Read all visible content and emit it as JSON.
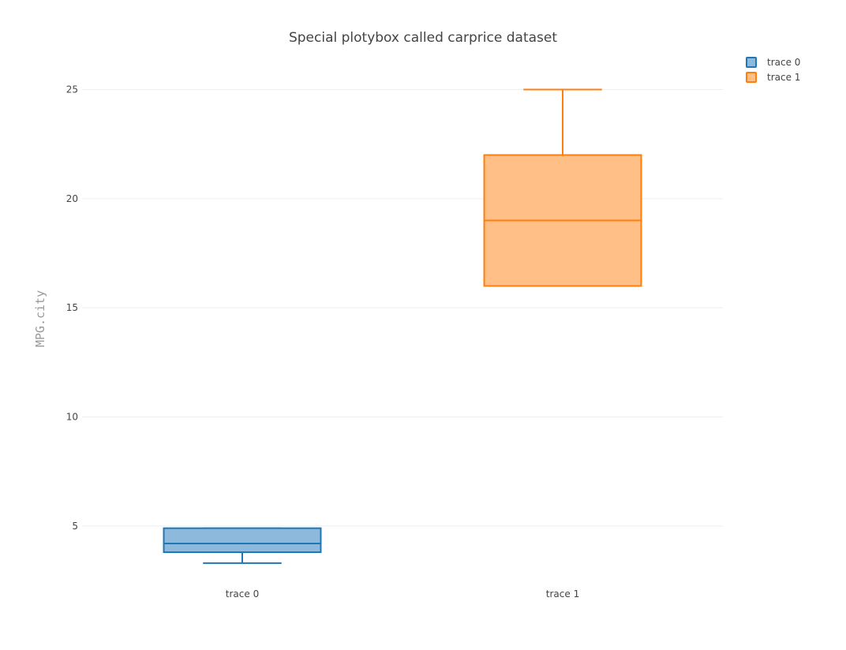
{
  "chart_data": {
    "type": "box",
    "title": "Special plotybox called carprice dataset",
    "xlabel": "",
    "ylabel": "MPG.city",
    "ylim": [
      2.5,
      26.5
    ],
    "yticks": [
      5,
      10,
      15,
      20,
      25
    ],
    "grid": true,
    "legend_position": "top-right",
    "categories": [
      "trace 0",
      "trace 1"
    ],
    "series": [
      {
        "name": "trace 0",
        "min": 3.3,
        "q1": 3.8,
        "median": 4.2,
        "q3": 4.9,
        "max": 3.8,
        "color": "#1f77b4",
        "fill": "#8db9dc"
      },
      {
        "name": "trace 1",
        "min": 16,
        "q1": 16,
        "median": 19,
        "q3": 22,
        "max": 25,
        "color": "#ff7f0e",
        "fill": "#ffbf86"
      }
    ]
  }
}
